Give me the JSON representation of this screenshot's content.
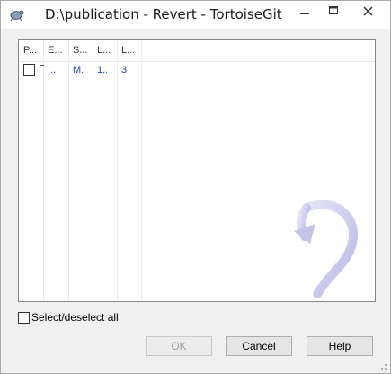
{
  "window": {
    "title": "D:\\publication - Revert - TortoiseGit",
    "app_icon": "tortoisegit-icon"
  },
  "titlebar_buttons": {
    "minimize_icon": "minimize-icon",
    "maximize_icon": "maximize-icon",
    "close_icon": "close-icon"
  },
  "file_list": {
    "columns": [
      "P...",
      "E...",
      "S...",
      "L...",
      "L..."
    ],
    "rows": [
      {
        "checked": false,
        "cells": [
          "",
          "...",
          "M.",
          "1..",
          "3"
        ]
      }
    ]
  },
  "watermark": "tortoisegit-revert-arrow",
  "select_all": {
    "label": "Select/deselect all",
    "checked": false
  },
  "buttons": {
    "ok": "OK",
    "cancel": "Cancel",
    "help": "Help"
  },
  "colors": {
    "titlebar_bg": "#ffffff",
    "dialog_bg": "#f0f0f0",
    "row_text": "#2244aa",
    "watermark": "#c9c9ee"
  }
}
